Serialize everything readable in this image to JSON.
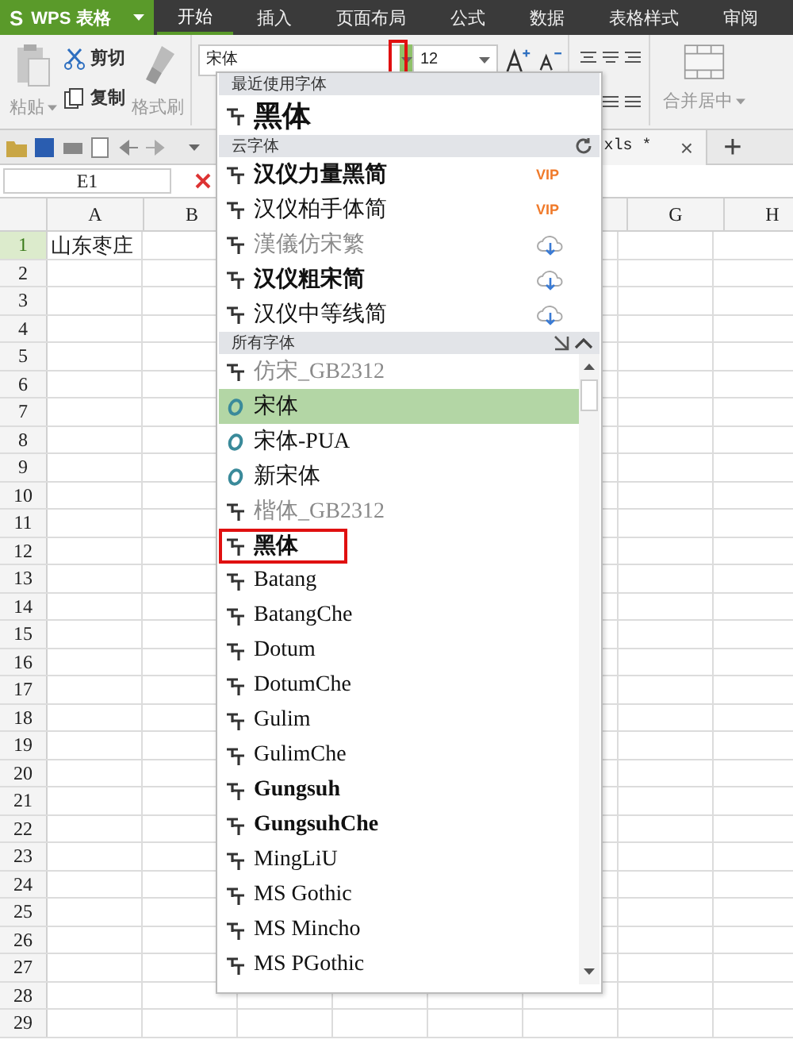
{
  "app_button": {
    "label": "WPS 表格",
    "logo": "S"
  },
  "tabs": [
    {
      "label": "开始",
      "selected": true
    },
    {
      "label": "插入",
      "selected": false
    },
    {
      "label": "页面布局",
      "selected": false
    },
    {
      "label": "公式",
      "selected": false
    },
    {
      "label": "数据",
      "selected": false
    },
    {
      "label": "表格样式",
      "selected": false
    },
    {
      "label": "审阅",
      "selected": false
    }
  ],
  "ribbon": {
    "paste": {
      "label": "粘贴",
      "disabled": true
    },
    "cut": {
      "label": "剪切",
      "disabled": false
    },
    "copy": {
      "label": "复制",
      "disabled": false
    },
    "format_painter": {
      "label": "格式刷",
      "disabled": true
    },
    "font_name": {
      "value": "宋体",
      "arrow_highlighted": true
    },
    "font_size": {
      "value": "12"
    },
    "merge": {
      "label": "合并居中",
      "disabled": true
    }
  },
  "document_tab": {
    "label": "xls *",
    "close": "×"
  },
  "new_tab": "+",
  "name_box": {
    "value": "E1"
  },
  "sheet": {
    "columns": [
      "A",
      "B",
      "G",
      "H"
    ],
    "rows": [
      {
        "header": "1",
        "active": true,
        "cells": [
          "山东枣庄"
        ]
      },
      {
        "header": "2",
        "active": false
      },
      {
        "header": "3",
        "active": false
      },
      {
        "header": "4",
        "active": false
      },
      {
        "header": "5",
        "active": false
      },
      {
        "header": "6",
        "active": false
      },
      {
        "header": "7",
        "active": false
      },
      {
        "header": "8",
        "active": false
      },
      {
        "header": "9",
        "active": false
      },
      {
        "header": "10",
        "active": false
      },
      {
        "header": "11",
        "active": false
      },
      {
        "header": "12",
        "active": false
      },
      {
        "header": "13",
        "active": false
      },
      {
        "header": "14",
        "active": false
      },
      {
        "header": "15",
        "active": false
      },
      {
        "header": "16",
        "active": false
      },
      {
        "header": "17",
        "active": false
      },
      {
        "header": "18",
        "active": false
      },
      {
        "header": "19",
        "active": false
      },
      {
        "header": "20",
        "active": false
      },
      {
        "header": "21",
        "active": false
      },
      {
        "header": "22",
        "active": false
      },
      {
        "header": "23",
        "active": false
      },
      {
        "header": "24",
        "active": false
      },
      {
        "header": "25",
        "active": false
      },
      {
        "header": "26",
        "active": false
      },
      {
        "header": "27",
        "active": false
      },
      {
        "header": "28",
        "active": false
      },
      {
        "header": "29",
        "active": false
      }
    ]
  },
  "font_dropdown": {
    "sections": [
      {
        "title": "最近使用字体",
        "kind": "recent",
        "items": [
          {
            "name": "黑体",
            "kind": "truetype",
            "bold": true,
            "dim": false,
            "selected": false,
            "highlighted": false
          }
        ]
      },
      {
        "title": "云字体",
        "kind": "cloud",
        "items": [
          {
            "name": "汉仪力量黑简",
            "kind": "truetype",
            "bold": true,
            "dim": false,
            "badge": "VIP",
            "selected": false,
            "highlighted": false
          },
          {
            "name": "汉仪柏手体简",
            "kind": "truetype",
            "bold": false,
            "dim": false,
            "badge": "VIP",
            "selected": false,
            "highlighted": false
          },
          {
            "name": "漢儀仿宋繁",
            "kind": "truetype",
            "bold": false,
            "dim": true,
            "download": true,
            "selected": false,
            "highlighted": false
          },
          {
            "name": "汉仪粗宋简",
            "kind": "truetype",
            "bold": true,
            "dim": false,
            "download": true,
            "selected": false,
            "highlighted": false
          },
          {
            "name": "汉仪中等线简",
            "kind": "truetype",
            "bold": false,
            "dim": false,
            "download": true,
            "selected": false,
            "highlighted": false
          }
        ]
      },
      {
        "title": "所有字体",
        "kind": "all",
        "items": [
          {
            "name": "仿宋_GB2312",
            "kind": "truetype",
            "bold": false,
            "dim": true,
            "selected": false,
            "highlighted": false
          },
          {
            "name": "宋体",
            "kind": "opentype",
            "bold": false,
            "dim": false,
            "selected": true,
            "highlighted": false
          },
          {
            "name": "宋体-PUA",
            "kind": "opentype",
            "bold": false,
            "dim": false,
            "selected": false,
            "highlighted": false
          },
          {
            "name": "新宋体",
            "kind": "opentype",
            "bold": false,
            "dim": false,
            "selected": false,
            "highlighted": false
          },
          {
            "name": "楷体_GB2312",
            "kind": "truetype",
            "bold": false,
            "dim": true,
            "selected": false,
            "highlighted": false
          },
          {
            "name": "黑体",
            "kind": "truetype",
            "bold": true,
            "dim": false,
            "selected": false,
            "highlighted": true
          },
          {
            "name": "Batang",
            "kind": "truetype",
            "bold": false,
            "dim": false,
            "selected": false,
            "highlighted": false
          },
          {
            "name": "BatangChe",
            "kind": "truetype",
            "bold": false,
            "dim": false,
            "selected": false,
            "highlighted": false
          },
          {
            "name": "Dotum",
            "kind": "truetype",
            "bold": false,
            "dim": false,
            "selected": false,
            "highlighted": false
          },
          {
            "name": "DotumChe",
            "kind": "truetype",
            "bold": false,
            "dim": false,
            "selected": false,
            "highlighted": false
          },
          {
            "name": "Gulim",
            "kind": "truetype",
            "bold": false,
            "dim": false,
            "selected": false,
            "highlighted": false
          },
          {
            "name": "GulimChe",
            "kind": "truetype",
            "bold": false,
            "dim": false,
            "selected": false,
            "highlighted": false
          },
          {
            "name": "Gungsuh",
            "kind": "truetype",
            "bold": true,
            "dim": false,
            "selected": false,
            "highlighted": false
          },
          {
            "name": "GungsuhChe",
            "kind": "truetype",
            "bold": true,
            "dim": false,
            "selected": false,
            "highlighted": false
          },
          {
            "name": "MingLiU",
            "kind": "truetype",
            "bold": false,
            "dim": false,
            "selected": false,
            "highlighted": false
          },
          {
            "name": "MS Gothic",
            "kind": "truetype",
            "bold": false,
            "dim": false,
            "selected": false,
            "highlighted": false
          },
          {
            "name": "MS Mincho",
            "kind": "truetype",
            "bold": false,
            "dim": false,
            "selected": false,
            "highlighted": false
          },
          {
            "name": "MS PGothic",
            "kind": "truetype",
            "bold": false,
            "dim": false,
            "selected": false,
            "highlighted": false
          }
        ]
      }
    ]
  }
}
